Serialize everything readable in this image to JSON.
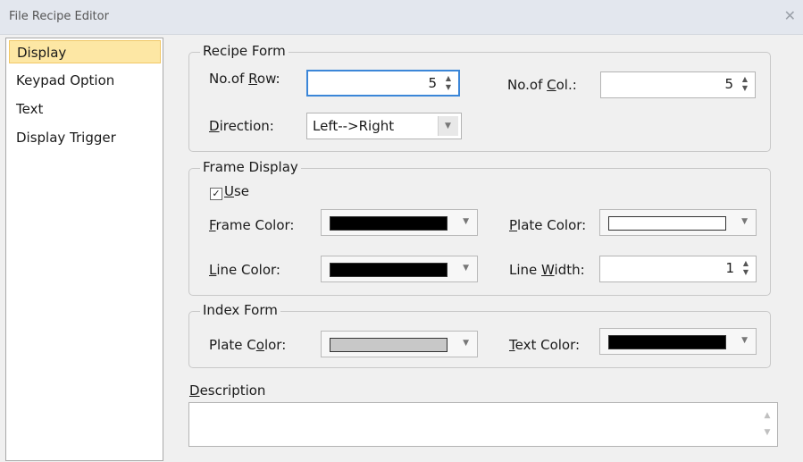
{
  "window": {
    "title": "File Recipe Editor",
    "close_glyph": "✕"
  },
  "nav": {
    "items": [
      {
        "label": "Display",
        "selected": true
      },
      {
        "label": "Keypad Option"
      },
      {
        "label": "Text"
      },
      {
        "label": "Display Trigger"
      }
    ]
  },
  "recipe_form": {
    "legend": "Recipe Form",
    "rows": {
      "label_pre": "No.of ",
      "label_key": "R",
      "label_post": "ow:",
      "value": "5"
    },
    "cols": {
      "label_pre": "No.of ",
      "label_key": "C",
      "label_post": "ol.:",
      "value": "5"
    },
    "direction": {
      "label_key": "D",
      "label_post": "irection:",
      "value": "Left-->Right"
    }
  },
  "frame_display": {
    "legend": "Frame Display",
    "use": {
      "label_key": "U",
      "label_post": "se",
      "checked": true
    },
    "frame_color": {
      "label_key": "F",
      "label_post": "rame Color:",
      "color": "#000000"
    },
    "plate_color": {
      "label_key": "P",
      "label_post": "late Color:",
      "color": "#ffffff"
    },
    "line_color": {
      "label_key": "L",
      "label_post": "ine Color:",
      "color": "#000000"
    },
    "line_width": {
      "label_pre": "Line ",
      "label_key": "W",
      "label_post": "idth:",
      "value": "1"
    }
  },
  "index_form": {
    "legend": "Index Form",
    "plate_color": {
      "label_pre": "Plate C",
      "label_key": "o",
      "label_post": "lor:",
      "color": "#c8c8c8"
    },
    "text_color": {
      "label_key": "T",
      "label_post": "ext Color:",
      "color": "#000000"
    }
  },
  "description": {
    "label_key": "D",
    "label_post": "escription",
    "value": ""
  },
  "glyphs": {
    "up": "▲",
    "down": "▼",
    "check": "✓"
  }
}
